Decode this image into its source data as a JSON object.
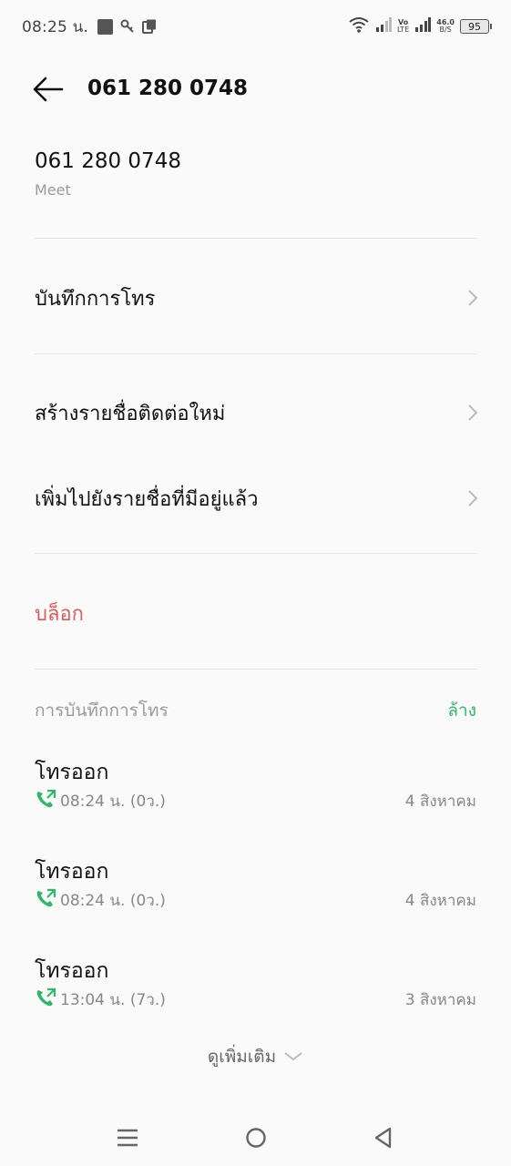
{
  "status_bar": {
    "time": "08:25 น.",
    "volte": [
      "Vo",
      "LTE"
    ],
    "net_speed": [
      "46.0",
      "B/S"
    ],
    "battery": "95",
    "icons": [
      "stop-icon",
      "key-icon",
      "notification-icon",
      "wifi-icon",
      "signal-icon",
      "signal-icon"
    ]
  },
  "header": {
    "title": "061 280 0748"
  },
  "contact": {
    "number": "061 280 0748",
    "label": "Meet"
  },
  "actions": {
    "call_log": "บันทึกการโทร",
    "create_contact": "สร้างรายชื่อติดต่อใหม่",
    "add_existing": "เพิ่มไปยังรายชื่อที่มีอยู่แล้ว",
    "block": "บล็อก"
  },
  "history": {
    "title": "การบันทึกการโทร",
    "clear": "ล้าง",
    "items": [
      {
        "type": "โทรออก",
        "time": "08:24 น.  (0ว.)",
        "date": "4 สิงหาคม"
      },
      {
        "type": "โทรออก",
        "time": "08:24 น.  (0ว.)",
        "date": "4 สิงหาคม"
      },
      {
        "type": "โทรออก",
        "time": "13:04 น.  (7ว.)",
        "date": "3 สิงหาคม"
      }
    ],
    "see_more": "ดูเพิ่มเติม"
  },
  "colors": {
    "accent_green": "#2fb86a",
    "danger_red": "#e05c5c",
    "muted": "#9a9a9a"
  }
}
